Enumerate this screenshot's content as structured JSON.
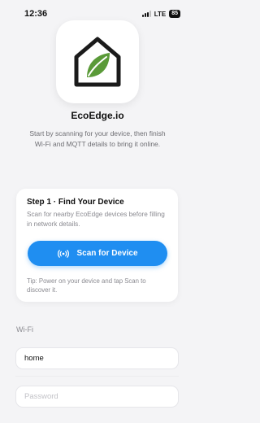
{
  "status": {
    "time": "12:36",
    "network": "LTE",
    "battery": "85"
  },
  "app": {
    "name": "EcoEdge.io",
    "intro": "Start by scanning for your device, then finish Wi-Fi and MQTT details to bring it online."
  },
  "step": {
    "title": "Step 1 · Find Your Device",
    "description": "Scan for nearby EcoEdge devices before filling in network details.",
    "scan_label": "Scan for Device",
    "tip": "Tip: Power on your device and tap Scan to discover it."
  },
  "wifi": {
    "section_label": "Wi-Fi",
    "ssid_value": "home",
    "password_placeholder": "Password"
  },
  "colors": {
    "accent": "#1f8ef1",
    "leaf": "#5a9a38",
    "house_outline": "#1b1b1b"
  },
  "icons": {
    "app": "house-leaf-icon",
    "scan": "radar-waves-icon"
  }
}
